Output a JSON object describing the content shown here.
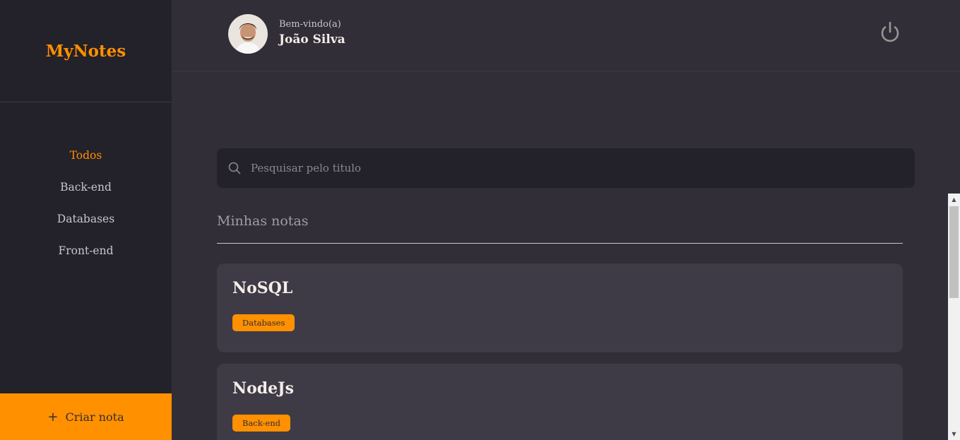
{
  "brand": {
    "title": "MyNotes"
  },
  "sidebar": {
    "items": [
      {
        "label": "Todos",
        "active": true
      },
      {
        "label": "Back-end",
        "active": false
      },
      {
        "label": "Databases",
        "active": false
      },
      {
        "label": "Front-end",
        "active": false
      }
    ],
    "create_label": "Criar nota",
    "create_icon": "plus-icon"
  },
  "header": {
    "welcome": "Bem-vindo(a)",
    "user_name": "João Silva",
    "logout_icon": "power-icon"
  },
  "search": {
    "placeholder": "Pesquisar pelo titulo",
    "value": "",
    "icon": "search-icon"
  },
  "section": {
    "title": "Minhas notas"
  },
  "notes": [
    {
      "title": "NoSQL",
      "tags": [
        "Databases"
      ]
    },
    {
      "title": "NodeJs",
      "tags": [
        "Back-end"
      ]
    }
  ],
  "colors": {
    "accent": "#ff9000",
    "sidebar_bg": "#232129",
    "page_bg": "#312e38",
    "card_bg": "#3e3b47"
  }
}
